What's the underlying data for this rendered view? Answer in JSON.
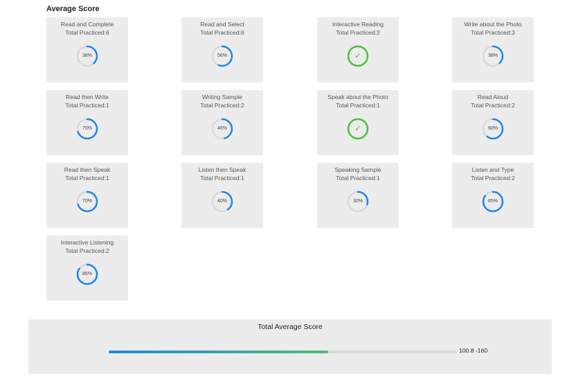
{
  "heading": "Average Score",
  "colors": {
    "ring_progress": "#1f86e6",
    "ring_track": "#d9d9d9",
    "check": "#4cc13a",
    "card_bg": "#ececec"
  },
  "cards": [
    {
      "title": "Read and Complete",
      "count_text": "Total Practiced:6",
      "percent": 38,
      "label": "38%",
      "completed": false
    },
    {
      "title": "Read and Select",
      "count_text": "Total Practiced:6",
      "percent": 56,
      "label": "56%",
      "completed": false
    },
    {
      "title": "Interactive Reading",
      "count_text": "Total Practiced:2",
      "percent": 100,
      "label": "",
      "completed": true
    },
    {
      "title": "Write about the Photo",
      "count_text": "Total Practiced:3",
      "percent": 38,
      "label": "38%",
      "completed": false
    },
    {
      "title": "Read then Write",
      "count_text": "Total Practiced:1",
      "percent": 70,
      "label": "70%",
      "completed": false
    },
    {
      "title": "Writing Sample",
      "count_text": "Total Practiced:2",
      "percent": 46,
      "label": "46%",
      "completed": false
    },
    {
      "title": "Speak about the Photo",
      "count_text": "Total Practiced:1",
      "percent": 100,
      "label": "",
      "completed": true
    },
    {
      "title": "Read Aloud",
      "count_text": "Total Practiced:2",
      "percent": 60,
      "label": "60%",
      "completed": false
    },
    {
      "title": "Read then Speak",
      "count_text": "Total Practiced:1",
      "percent": 70,
      "label": "70%",
      "completed": false
    },
    {
      "title": "Listen then Speak",
      "count_text": "Total Practiced:1",
      "percent": 40,
      "label": "40%",
      "completed": false
    },
    {
      "title": "Speaking Sample",
      "count_text": "Total Practiced:1",
      "percent": 30,
      "label": "30%",
      "completed": false
    },
    {
      "title": "Listen and Type",
      "count_text": "Total Practiced:2",
      "percent": 85,
      "label": "85%",
      "completed": false
    },
    {
      "title": "Interactive Listening",
      "count_text": "Total Practiced:2",
      "percent": 85,
      "label": "85%",
      "completed": false
    }
  ],
  "total": {
    "title": "Total Average Score",
    "progress": 0.63,
    "range_text": "100.8 -160"
  }
}
